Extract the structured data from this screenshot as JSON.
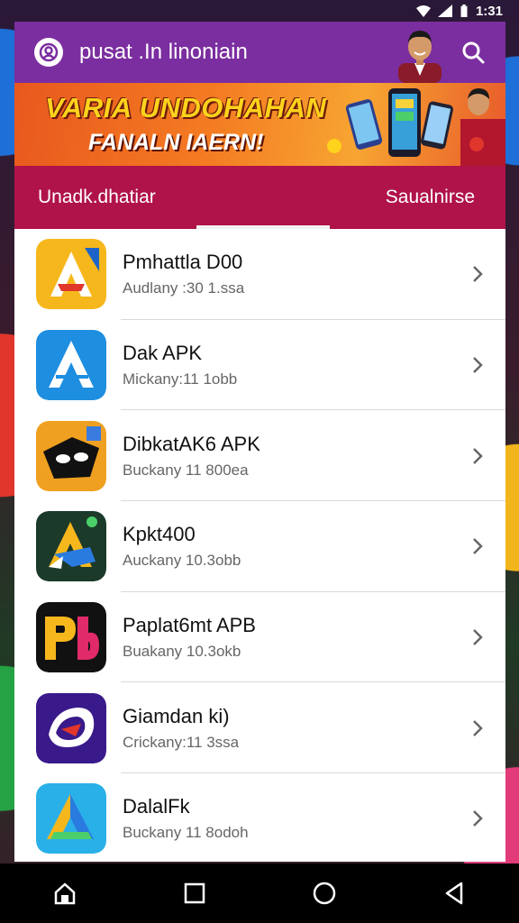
{
  "status_bar": {
    "time": "1:31"
  },
  "header": {
    "title": "pusat .In linoniain",
    "logo_icon": "user-circle-icon",
    "search_icon": "search-icon",
    "accent_color": "#7b2ea0"
  },
  "banner": {
    "line1": "VARIA UNDOHAHAN",
    "line2": "FANALN IAERN!"
  },
  "tabs": [
    {
      "label": "Unadk.dhatiar"
    },
    {
      "label": "Saualnirse"
    }
  ],
  "apps": [
    {
      "name": "Pmhattla D00",
      "sub": "Audlany :30 1.ssa",
      "icon": "a-logo-yellow-icon"
    },
    {
      "name": "Dak APK",
      "sub": "Mickany:11 1obb",
      "icon": "a-logo-blue-icon"
    },
    {
      "name": "DibkatAK6 APK",
      "sub": "Buckany 11 800ea",
      "icon": "mask-logo-icon"
    },
    {
      "name": "Kpkt400",
      "sub": "Auckany 10.3obb",
      "icon": "a-logo-dark-icon"
    },
    {
      "name": "Paplat6mt APB",
      "sub": "Buakany 10.3okb",
      "icon": "pb-logo-icon"
    },
    {
      "name": "Giamdan ki)",
      "sub": "Crickany:11 3ssa",
      "icon": "swirl-logo-icon"
    },
    {
      "name": "DalalFk",
      "sub": "Buckany 11 8odoh",
      "icon": "a-logo-cyan-icon"
    }
  ],
  "navbar": {
    "home_icon": "home-icon",
    "recents_icon": "square-icon",
    "home_circle_icon": "circle-icon",
    "back_icon": "back-triangle-icon"
  }
}
